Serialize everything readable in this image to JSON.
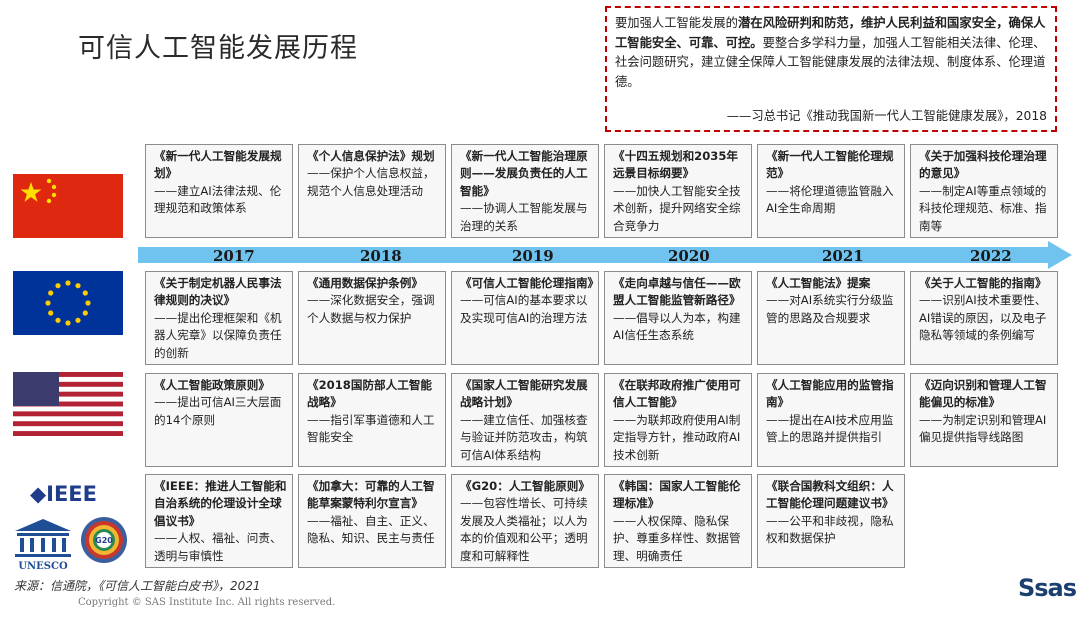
{
  "page_title": "可信人工智能发展历程",
  "quote": {
    "bold_part": "潜在风险研判和防范，维护人民利益和国家安全，确保人工智能安全、可靠、可控。",
    "prefix": "要加强人工智能发展的",
    "rest": "要整合多学科力量，加强人工智能相关法律、伦理、社会问题研究，建立健全保障人工智能健康发展的法律法规、制度体系、伦理道德。",
    "source": "——习总书记《推动我国新一代人工智能健康发展》，2018"
  },
  "years": [
    "2017",
    "2018",
    "2019",
    "2020",
    "2021",
    "2022"
  ],
  "rows": [
    {
      "region": "china",
      "cards": [
        {
          "title": "《新一代人工智能发展规划》",
          "desc": "——建立AI法律法规、伦理规范和政策体系"
        },
        {
          "title": "《个人信息保护法》规划",
          "desc": "——保护个人信息权益，规范个人信息处理活动"
        },
        {
          "title": "《新一代人工智能治理原则——发展负责任的人工智能》",
          "desc": "——协调人工智能发展与治理的关系"
        },
        {
          "title": "《十四五规划和2035年远景目标纲要》",
          "desc": "——加快人工智能安全技术创新，提升网络安全综合竞争力"
        },
        {
          "title": "《新一代人工智能伦理规范》",
          "desc": "——将伦理道德监管融入AI全生命周期"
        },
        {
          "title": "《关于加强科技伦理治理的意见》",
          "desc": "——制定AI等重点领域的科技伦理规范、标准、指南等"
        }
      ]
    },
    {
      "region": "eu",
      "cards": [
        {
          "title": "《关于制定机器人民事法律规则的决议》",
          "desc": "——提出伦理框架和《机器人宪章》以保障负责任的创新"
        },
        {
          "title": "《通用数据保护条例》",
          "desc": "——深化数据安全，强调个人数据与权力保护"
        },
        {
          "title": "《可信人工智能伦理指南》",
          "desc": "——可信AI的基本要求以及实现可信AI的治理方法"
        },
        {
          "title": "《走向卓越与信任——欧盟人工智能监管新路径》",
          "desc": "——倡导以人为本，构建AI信任生态系统"
        },
        {
          "title": "《人工智能法》提案",
          "desc": "——对AI系统实行分级监管的思路及合规要求"
        },
        {
          "title": "《关于人工智能的指南》",
          "desc": "——识别AI技术重要性、AI错误的原因，以及电子隐私等领域的条例编写"
        }
      ]
    },
    {
      "region": "us",
      "cards": [
        {
          "title": "《人工智能政策原则》",
          "desc": "——提出可信AI三大层面的14个原则"
        },
        {
          "title": "《2018国防部人工智能战略》",
          "desc": "——指引军事道德和人工智能安全"
        },
        {
          "title": "《国家人工智能研究发展战略计划》",
          "desc": "——建立信任、加强核查与验证并防范攻击，构筑可信AI体系结构"
        },
        {
          "title": "《在联邦政府推广使用可信人工智能》",
          "desc": "——为联邦政府使用AI制定指导方针，推动政府AI技术创新"
        },
        {
          "title": "《人工智能应用的监管指南》",
          "desc": "——提出在AI技术应用监管上的思路并提供指引"
        },
        {
          "title": "《迈向识别和管理人工智能偏见的标准》",
          "desc": "——为制定识别和管理AI偏见提供指导线路图"
        }
      ]
    },
    {
      "region": "intl",
      "cards": [
        {
          "title": "《IEEE：推进人工智能和自治系统的伦理设计全球倡议书》",
          "desc": "——人权、福祉、问责、透明与审慎性"
        },
        {
          "title": "《加拿大：可靠的人工智能草案蒙特利尔宣言》",
          "desc": "——福祉、自主、正义、隐私、知识、民主与责任"
        },
        {
          "title": "《G20：人工智能原则》",
          "desc": "——包容性增长、可持续发展及人类福祉；以人为本的价值观和公平；透明度和可解释性"
        },
        {
          "title": "《韩国：国家人工智能伦理标准》",
          "desc": "——人权保障、隐私保护、尊重多样性、数据管理、明确责任"
        },
        {
          "title": "《联合国教科文组织：人工智能伦理问题建议书》",
          "desc": "——公平和非歧视，隐私权和数据保护"
        },
        {
          "title": "",
          "desc": ""
        }
      ]
    }
  ],
  "logos": {
    "ieee": "◆IEEE",
    "unesco": "UNESCO",
    "g20": "G20"
  },
  "footer": {
    "source": "来源：信通院，《可信人工智能白皮书》，2021",
    "copyright": "Copyright © SAS Institute Inc. All rights reserved.",
    "brand": "Ssas"
  },
  "colors": {
    "arrow": "#6fc3ee",
    "china_red": "#de2910",
    "eu_blue": "#003399",
    "quote_border": "#c00000"
  }
}
